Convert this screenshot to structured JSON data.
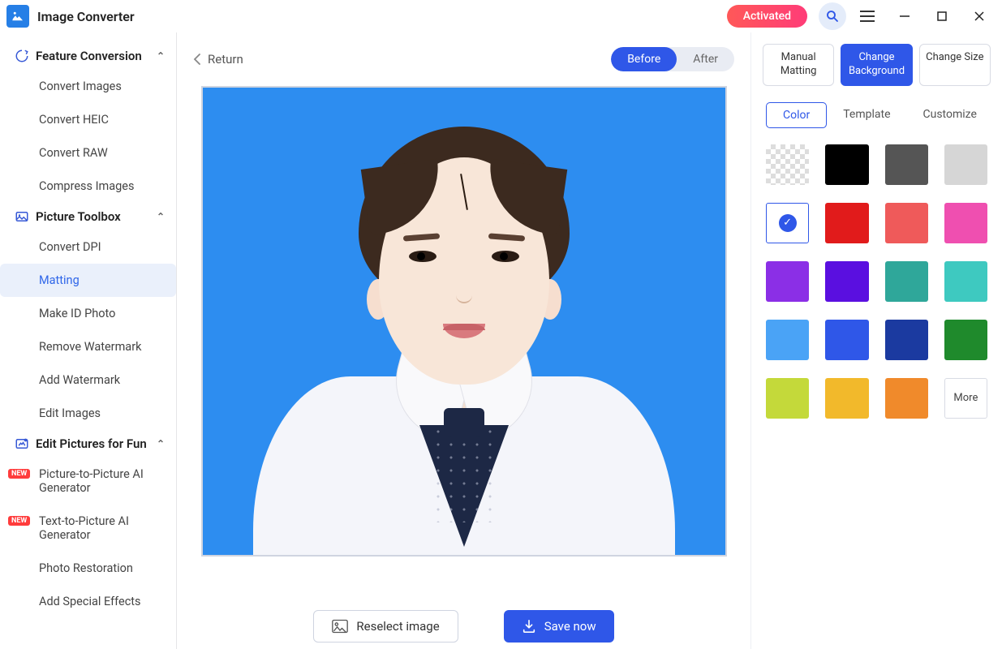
{
  "titlebar": {
    "app_name": "Image Converter",
    "activated": "Activated"
  },
  "sidebar": {
    "sections": [
      {
        "title": "Feature Conversion",
        "items": [
          "Convert Images",
          "Convert HEIC",
          "Convert RAW",
          "Compress Images"
        ]
      },
      {
        "title": "Picture Toolbox",
        "items": [
          "Convert DPI",
          "Matting",
          "Make ID Photo",
          "Remove Watermark",
          "Add Watermark",
          "Edit Images"
        ]
      },
      {
        "title": "Edit Pictures for Fun",
        "items": [
          "Picture-to-Picture AI Generator",
          "Text-to-Picture AI Generator",
          "Photo Restoration",
          "Add Special Effects"
        ]
      }
    ],
    "active": "Matting",
    "new_items": [
      "Picture-to-Picture AI Generator",
      "Text-to-Picture AI Generator"
    ]
  },
  "editor": {
    "return_label": "Return",
    "toggle": {
      "before": "Before",
      "after": "After",
      "active": "Before"
    },
    "reselect": "Reselect image",
    "save": "Save now",
    "canvas_bg": "#2d8df0"
  },
  "right_panel": {
    "actions": [
      {
        "label": "Manual Matting",
        "active": false
      },
      {
        "label": "Change Background",
        "active": true
      },
      {
        "label": "Change Size",
        "active": false
      }
    ],
    "tabs": [
      {
        "label": "Color",
        "active": true
      },
      {
        "label": "Template",
        "active": false
      },
      {
        "label": "Customize",
        "active": false
      }
    ],
    "swatches": [
      {
        "color": "transparent"
      },
      {
        "color": "#000000"
      },
      {
        "color": "#555555"
      },
      {
        "color": "#d6d6d6"
      },
      {
        "color": "#ffffff",
        "selected": true
      },
      {
        "color": "#e11b1b"
      },
      {
        "color": "#ef5a5a"
      },
      {
        "color": "#ef4fb0"
      },
      {
        "color": "#8b2fe6"
      },
      {
        "color": "#5a0fe0"
      },
      {
        "color": "#2fa79a"
      },
      {
        "color": "#3ec9c0"
      },
      {
        "color": "#4aa3f6"
      },
      {
        "color": "#2f57e8"
      },
      {
        "color": "#1b3aa0"
      },
      {
        "color": "#1f8a2c"
      },
      {
        "color": "#c4d93a"
      },
      {
        "color": "#f2b92b"
      },
      {
        "color": "#f08a2b"
      }
    ],
    "more": "More"
  }
}
